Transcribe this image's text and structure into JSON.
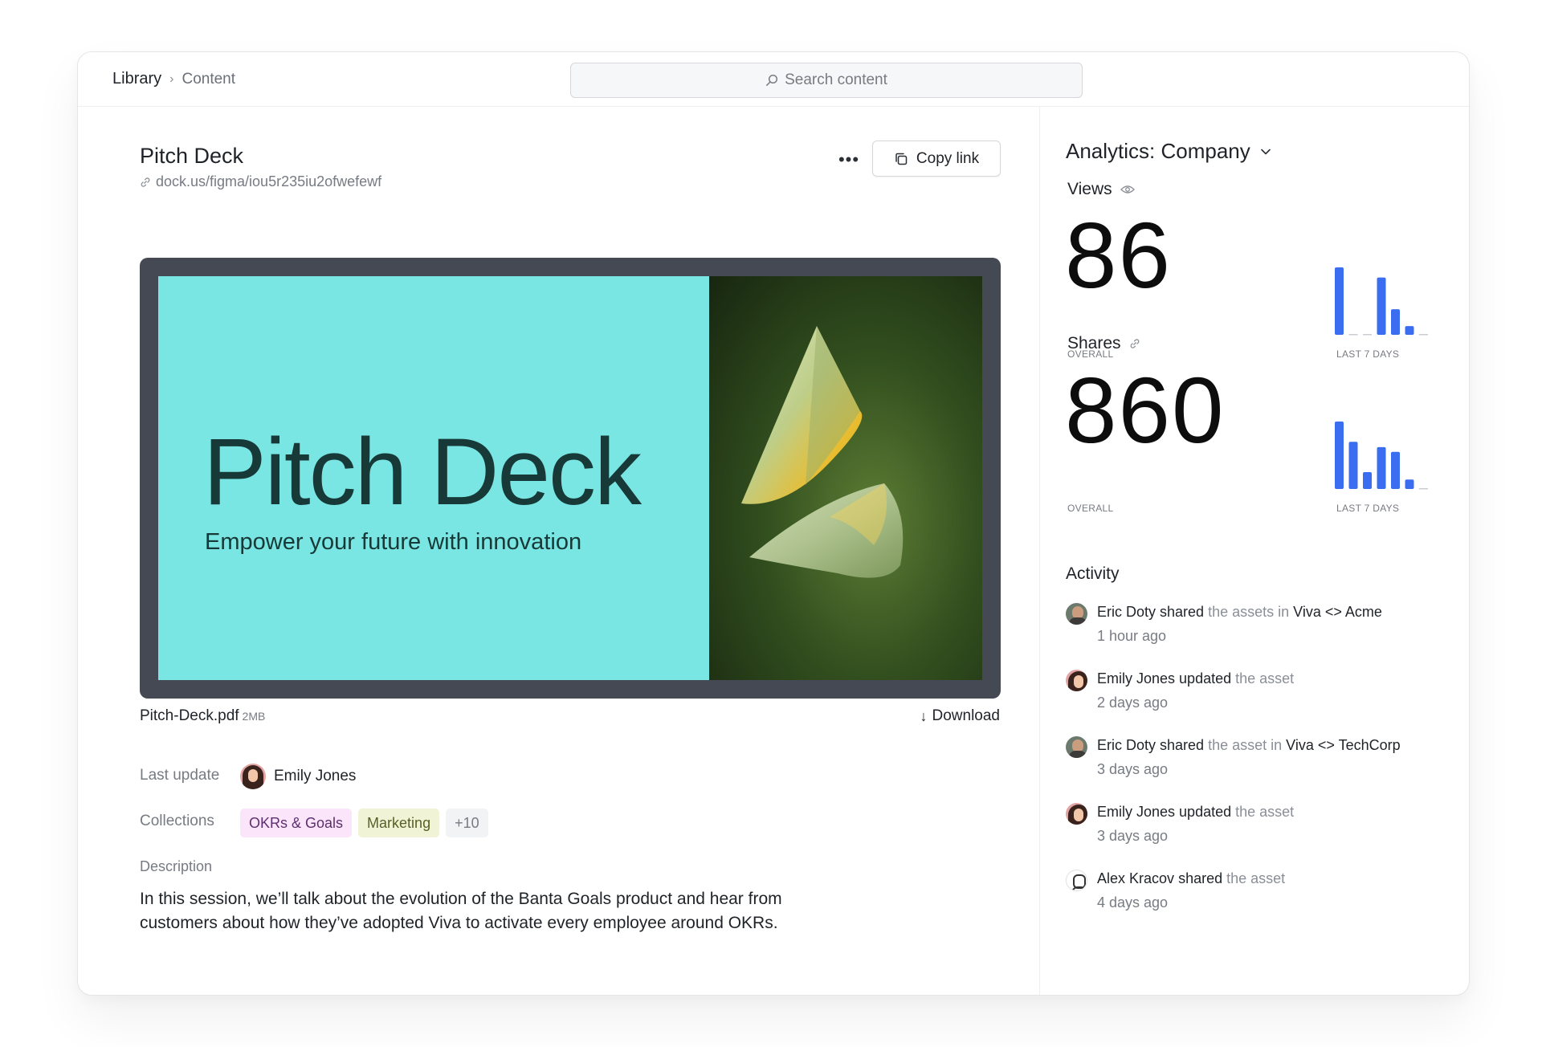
{
  "breadcrumb": {
    "root": "Library",
    "current": "Content"
  },
  "search": {
    "placeholder": "Search content"
  },
  "document": {
    "title": "Pitch Deck",
    "url": "dock.us/figma/iou5r235iu2ofwefewf",
    "more_label": "•••",
    "copy_link_label": "Copy link",
    "slide_title": "Pitch Deck",
    "slide_subtitle": "Empower your future with innovation",
    "file_name": "Pitch-Deck.pdf",
    "file_size": "2MB",
    "download_label": "Download",
    "last_update_label": "Last update",
    "last_update_user": "Emily Jones",
    "collections_label": "Collections",
    "collections": [
      {
        "label": "OKRs & Goals"
      },
      {
        "label": "Marketing"
      },
      {
        "label": "+10"
      }
    ],
    "description_label": "Description",
    "description": "In this session, we’ll talk about the evolution of the Banta Goals product and hear from customers about how they’ve adopted Viva to activate every employee around OKRs."
  },
  "analytics": {
    "title": "Analytics: Company",
    "views": {
      "label": "Views",
      "value": "86",
      "overall_caption": "OVERALL",
      "week_caption": "LAST 7 DAYS"
    },
    "shares": {
      "label": "Shares",
      "value": "860",
      "overall_caption": "OVERALL",
      "week_caption": "LAST 7 DAYS"
    }
  },
  "chart_data": [
    {
      "type": "bar",
      "categories": [
        "1",
        "2",
        "3",
        "4",
        "5",
        "6",
        "7"
      ],
      "values": [
        100,
        0,
        0,
        85,
        38,
        13,
        0
      ]
    },
    {
      "type": "bar",
      "categories": [
        "1",
        "2",
        "3",
        "4",
        "5",
        "6",
        "7"
      ],
      "values": [
        100,
        70,
        25,
        62,
        55,
        14,
        0
      ]
    }
  ],
  "activity": {
    "title": "Activity",
    "items": [
      {
        "user": "Eric Doty",
        "verb": "shared",
        "detail": "the assets in",
        "target": "Viva <> Acme",
        "time": "1 hour ago",
        "avatar": "eric"
      },
      {
        "user": "Emily Jones",
        "verb": "updated",
        "detail": "the asset",
        "target": "",
        "time": "2 days ago",
        "avatar": "emily"
      },
      {
        "user": "Eric Doty",
        "verb": "shared",
        "detail": "the asset in",
        "target": "Viva <> TechCorp",
        "time": "3 days ago",
        "avatar": "eric"
      },
      {
        "user": "Emily Jones",
        "verb": "updated",
        "detail": "the asset",
        "target": "",
        "time": "3 days ago",
        "avatar": "emily"
      },
      {
        "user": "Alex Kracov",
        "verb": "shared",
        "detail": "the asset",
        "target": "",
        "time": "4 days ago",
        "avatar": "alex"
      }
    ]
  },
  "colors": {
    "accent": "#3a6df0",
    "slide_bg": "#7ae6e3",
    "slide_text": "#173a38"
  }
}
